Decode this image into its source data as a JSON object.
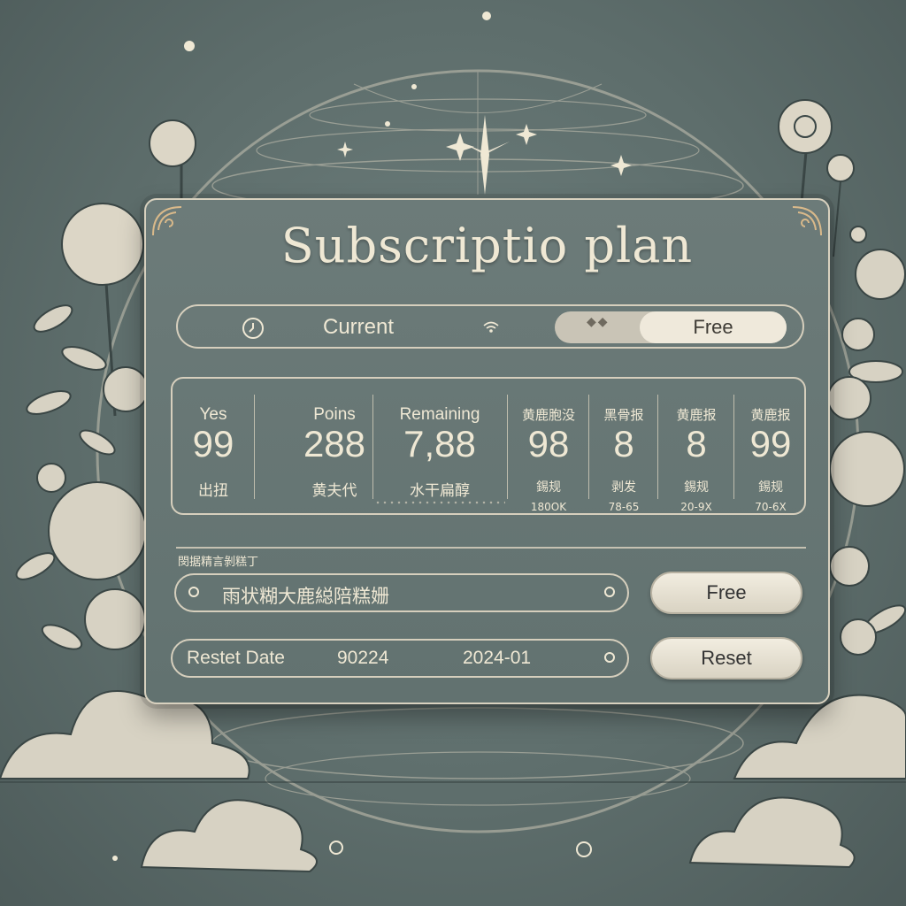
{
  "title": "Subscriptio plan",
  "current": {
    "label": "Current",
    "toggle_value": "Free",
    "toggle_glyph": "◆◆"
  },
  "stats": [
    {
      "label": "Yes",
      "value": "99",
      "sub": "出扭",
      "sub2": ""
    },
    {
      "label": "Poins",
      "value": "288",
      "sub": "黄夫代",
      "sub2": ""
    },
    {
      "label": "Remaining",
      "value": "7,88",
      "sub": "水干扁醇",
      "sub2": ""
    },
    {
      "label": "黄鹿胞没",
      "value": "98",
      "sub": "錫规",
      "sub2": "180OK"
    },
    {
      "label": "黑骨报",
      "value": "8",
      "sub": "剥发",
      "sub2": "78-65"
    },
    {
      "label": "黄鹿报",
      "value": "8",
      "sub": "錫规",
      "sub2": "20-9X"
    },
    {
      "label": "黄鹿报",
      "value": "99",
      "sub": "錫规",
      "sub2": "70-6X"
    }
  ],
  "section_heading": "閔据精言剝糕丁",
  "plan_row": {
    "text": "雨状糊大鹿縂陪糕姗",
    "button": "Free"
  },
  "reset_row": {
    "label": "Restet Date",
    "code": "90224",
    "date": "2024-01",
    "button": "Reset"
  }
}
